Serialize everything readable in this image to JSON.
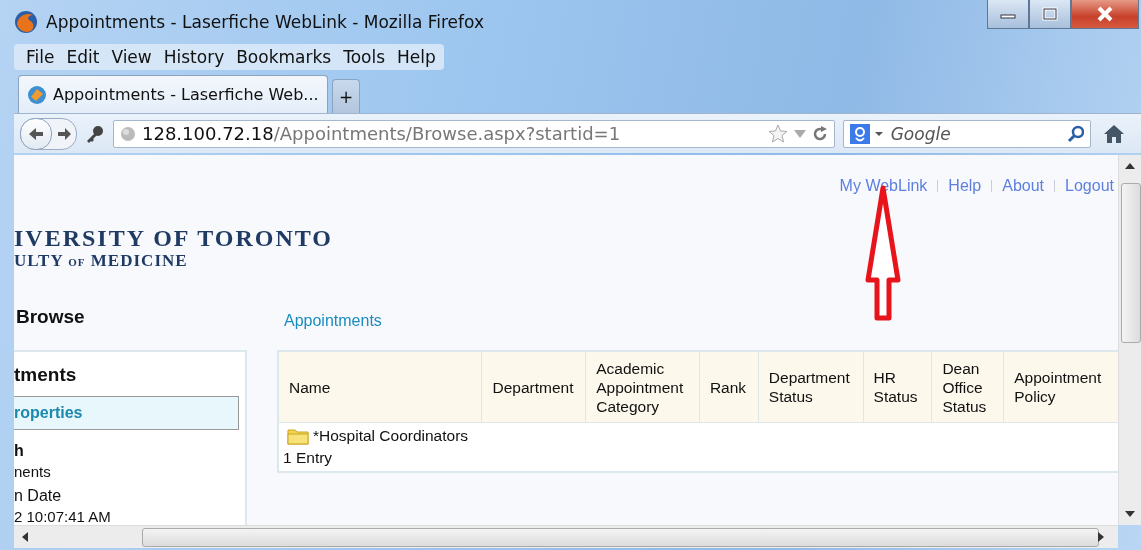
{
  "window": {
    "title": "Appointments - Laserfiche WebLink - Mozilla Firefox"
  },
  "menu": [
    {
      "label": "File"
    },
    {
      "label": "Edit"
    },
    {
      "label": "View"
    },
    {
      "label": "History"
    },
    {
      "label": "Bookmarks"
    },
    {
      "label": "Tools"
    },
    {
      "label": "Help"
    }
  ],
  "tabs": [
    {
      "label": "Appointments - Laserfiche Web...",
      "selected": true
    },
    {
      "label": "+",
      "selected": false
    }
  ],
  "address": {
    "host": "128.100.72.18",
    "path": "/Appointments/Browse.aspx?startid=1"
  },
  "search": {
    "placeholder": "Google"
  },
  "top_links": [
    "My WebLink",
    "Help",
    "About",
    "Logout"
  ],
  "logo": {
    "line1": "IVERSITY OF TORONTO",
    "line2": [
      "ULTY",
      "OF",
      "MEDICINE"
    ]
  },
  "sidebar": {
    "heading": "Browse",
    "title": "tments",
    "items": [
      {
        "label": "roperties",
        "selected": true
      }
    ],
    "fields": [
      "h",
      "nents",
      "n Date",
      "2 10:07:41 AM"
    ]
  },
  "breadcrumb": "Appointments",
  "table": {
    "columns": [
      "Name",
      "Department",
      "Academic Appointment Category",
      "Rank",
      "Department Status",
      "HR Status",
      "Dean Office Status",
      "Appointment Policy"
    ],
    "rows": [
      {
        "kind": "folder",
        "name": "*Hospital Coordinators"
      }
    ],
    "footer": "1 Entry"
  },
  "annotation": {
    "kind": "arrow"
  }
}
